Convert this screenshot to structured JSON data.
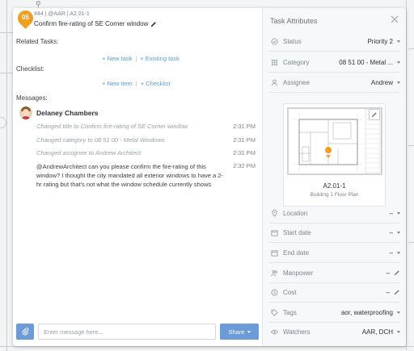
{
  "task": {
    "number": "05",
    "meta": "#44 | @AAR | A2.01-1",
    "title": "Confirm fire-rating of SE Corner window"
  },
  "related_tasks": {
    "label": "Related Tasks:",
    "new_link": "+ New task",
    "separator": "|",
    "existing_link": "+ Existing task"
  },
  "checklist": {
    "label": "Checklist:",
    "new_link": "+ New item",
    "separator": "|",
    "checklist_link": "+ Checklist"
  },
  "messages": {
    "label": "Messages:",
    "author": "Delaney Chambers",
    "log": [
      {
        "text": "Changed title to Confirm fire-rating of SE Corner window",
        "time": "2:31 PM"
      },
      {
        "text": "Changed category to 08 51 00 - Metal Windows",
        "time": "2:31 PM"
      },
      {
        "text": "Changed assignee to Andrew Architect",
        "time": "2:31 PM"
      }
    ],
    "message": {
      "text": "@AndrewArchitect can you please confirm the fire-rating of this window? I thought the city mandated all exterior windows to have a 2-hr rating but that's not what the window schedule currently shows",
      "time": "2:32 PM"
    }
  },
  "composer": {
    "placeholder": "Enter message here...",
    "share_label": "Share"
  },
  "attributes": {
    "title": "Task Attributes",
    "status": {
      "label": "Status",
      "value": "Priority 2"
    },
    "category": {
      "label": "Category",
      "value": "08 51 00 - Metal ..."
    },
    "assignee": {
      "label": "Assignee",
      "value": "Andrew"
    },
    "sheet": {
      "name": "A2.01-1",
      "subtitle": "Building 1 Floor Plan"
    },
    "location": {
      "label": "Location",
      "value": "–"
    },
    "start_date": {
      "label": "Start date",
      "value": "–"
    },
    "end_date": {
      "label": "End date",
      "value": "–"
    },
    "manpower": {
      "label": "Manpower",
      "value": "–"
    },
    "cost": {
      "label": "Cost",
      "value": "–"
    },
    "tags": {
      "label": "Tags",
      "value": "aor, waterproofing"
    },
    "watchers": {
      "label": "Watchers",
      "value": "AAR, DCH"
    }
  },
  "colors": {
    "pin": "#f0a021",
    "accent": "#6b9bd8",
    "link": "#5b9bd5"
  }
}
